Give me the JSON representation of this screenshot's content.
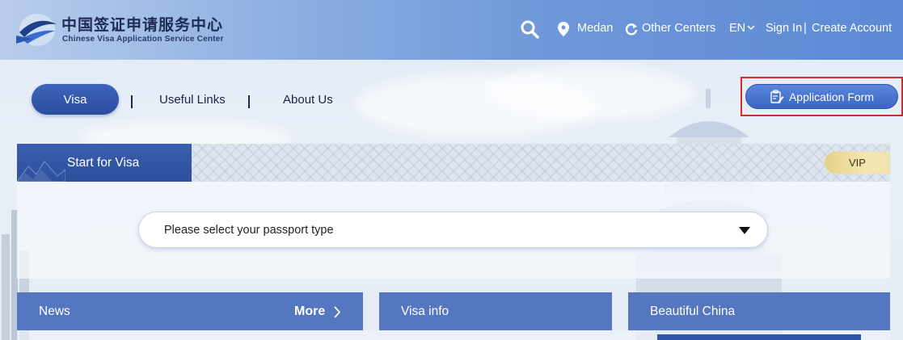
{
  "header": {
    "logo": {
      "cn_title": "中国签证申请服务中心",
      "en_title": "Chinese Visa Application Service Center"
    },
    "location": "Medan",
    "other_centers": "Other Centers",
    "language": "EN",
    "sign_in": "Sign In",
    "separator": "|",
    "create_account": "Create Account",
    "icons": {
      "search": "search-icon",
      "location": "location-pin-icon",
      "refresh": "refresh-icon",
      "language_chevron": "chevron-down-icon"
    }
  },
  "nav": {
    "tabs": [
      {
        "label": "Visa",
        "active": true
      },
      {
        "label": "Useful Links",
        "active": false
      },
      {
        "label": "About Us",
        "active": false
      }
    ],
    "separator": "|",
    "application_form": "Application Form"
  },
  "visa_panel": {
    "tab_label": "Start for Visa",
    "vip_label": "VIP",
    "passport_select": {
      "placeholder": "Please select your passport type"
    }
  },
  "sections": {
    "news": {
      "title": "News",
      "more": "More"
    },
    "visa_info": {
      "title": "Visa info"
    },
    "beautiful_china": {
      "title": "Beautiful China"
    }
  },
  "colors": {
    "header_gradient_end": "#5c89d4",
    "primary_blue": "#2d4f9c",
    "section_blue": "#5577c0",
    "highlight_red": "#d42a2a",
    "vip_gold": "#e6d183"
  }
}
